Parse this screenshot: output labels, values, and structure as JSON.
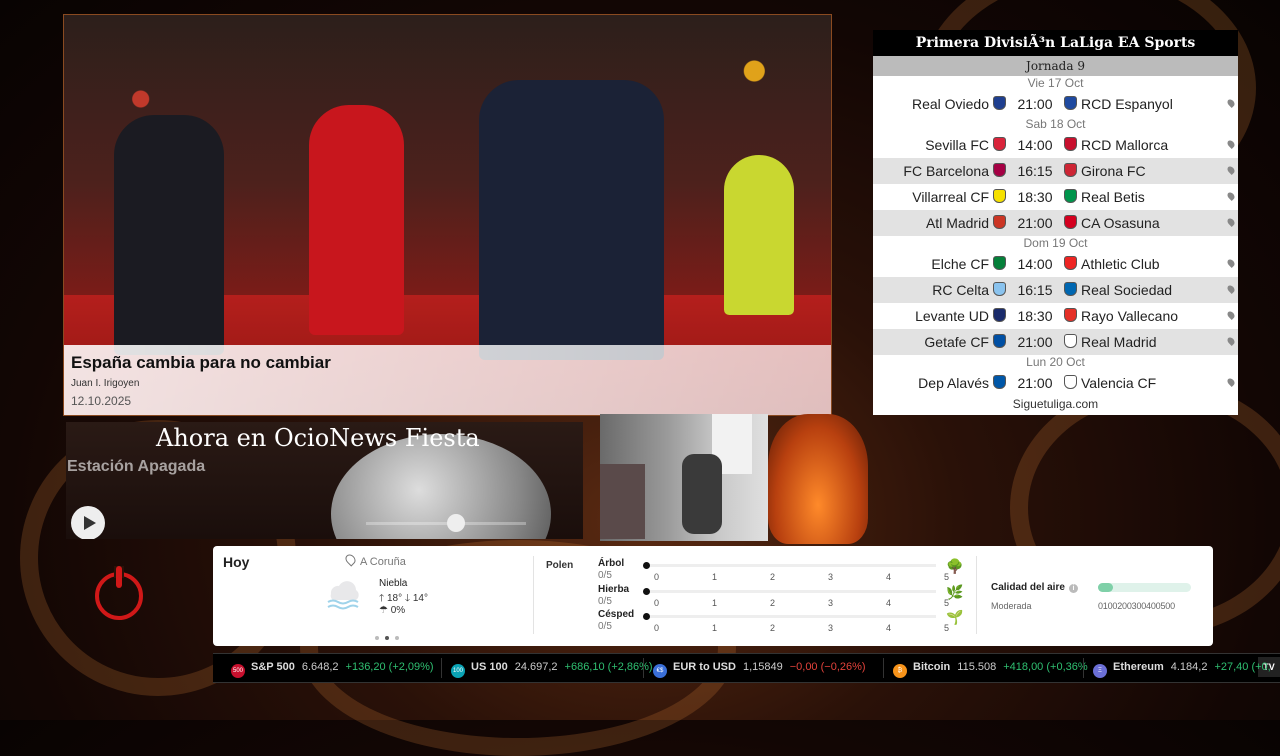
{
  "colors": {
    "accent": "#d01818",
    "up": "#2fbf71",
    "down": "#e2423b"
  },
  "news": {
    "title": "España cambia para no cambiar",
    "author": "Juan I. Irigoyen",
    "date": "12.10.2025"
  },
  "fixtures": {
    "title": "Primera DivisiÃ³n LaLiga EA Sports",
    "round": "Jornada 9",
    "days": [
      {
        "label": "Vie 17 Oct",
        "matches": [
          {
            "home": "Real Oviedo",
            "time": "21:00",
            "away": "RCD Espanyol",
            "home_color": "#1f3f8f",
            "away_color": "#1f4aa0"
          }
        ]
      },
      {
        "label": "Sab 18 Oct",
        "matches": [
          {
            "home": "Sevilla FC",
            "time": "14:00",
            "away": "RCD Mallorca",
            "home_color": "#d9243b",
            "away_color": "#c8102e"
          },
          {
            "home": "FC Barcelona",
            "time": "16:15",
            "away": "Girona FC",
            "home_color": "#a50044",
            "away_color": "#cd2534"
          },
          {
            "home": "Villarreal CF",
            "time": "18:30",
            "away": "Real Betis",
            "home_color": "#f5e100",
            "away_color": "#00954c"
          },
          {
            "home": "Atl Madrid",
            "time": "21:00",
            "away": "CA Osasuna",
            "home_color": "#cb3524",
            "away_color": "#d4001f"
          }
        ]
      },
      {
        "label": "Dom 19 Oct",
        "matches": [
          {
            "home": "Elche CF",
            "time": "14:00",
            "away": "Athletic Club",
            "home_color": "#05803a",
            "away_color": "#ee2523"
          },
          {
            "home": "RC Celta",
            "time": "16:15",
            "away": "Real Sociedad",
            "home_color": "#8ac3ee",
            "away_color": "#0067b1"
          },
          {
            "home": "Levante UD",
            "time": "18:30",
            "away": "Rayo Vallecano",
            "home_color": "#1a2b6b",
            "away_color": "#e53027"
          },
          {
            "home": "Getafe CF",
            "time": "21:00",
            "away": "Real Madrid",
            "home_color": "#004fa3",
            "away_color": "#ffffff"
          }
        ]
      },
      {
        "label": "Lun 20 Oct",
        "matches": [
          {
            "home": "Dep Alavés",
            "time": "21:00",
            "away": "Valencia CF",
            "home_color": "#0057a8",
            "away_color": "#ffffff"
          }
        ]
      }
    ],
    "footer": "Siguetuliga.com"
  },
  "radio": {
    "title": "Ahora en OcioNews Fiesta",
    "status": "Estación Apagada",
    "progress": 0.56
  },
  "weather": {
    "today": "Hoy",
    "location": "A Coruña",
    "condition": "Niebla",
    "temps": "🡑 18° 🡓 14°",
    "rain": "0%",
    "polen_label": "Polen",
    "polen": [
      {
        "name": "Árbol",
        "value": "0/5"
      },
      {
        "name": "Hierba",
        "value": "0/5"
      },
      {
        "name": "Césped",
        "value": "0/5"
      }
    ],
    "scale": [
      "0",
      "1",
      "2",
      "3",
      "4",
      "5"
    ],
    "air_quality_title": "Calidad del aire",
    "air_quality_level": "Moderada",
    "air_quality_fraction": 0.16,
    "air_quality_scale": "0100200300400500"
  },
  "ticker": [
    {
      "badge": "500",
      "badge_color": "#c8102e",
      "name": "S&P 500",
      "price": "6.648,2",
      "change": "+136,20 (+2,09%)",
      "dir": "up"
    },
    {
      "badge": "100",
      "badge_color": "#0aa3b5",
      "name": "US 100",
      "price": "24.697,2",
      "change": "+686,10 (+2,86%)",
      "dir": "up"
    },
    {
      "badge": "€$",
      "badge_color": "#3a6fd8",
      "name": "EUR to USD",
      "price": "1,15849",
      "change": "−0,00 (−0,26%)",
      "dir": "down"
    },
    {
      "badge": "₿",
      "badge_color": "#f7931a",
      "name": "Bitcoin",
      "price": "115.508",
      "change": "+418,00 (+0,36%",
      "dir": "up"
    },
    {
      "badge": "Ξ",
      "badge_color": "#6b6fd6",
      "name": "Ethereum",
      "price": "4.184,2",
      "change": "+27,40 (+0,",
      "dir": "up"
    }
  ],
  "ticker_logo": "TV"
}
